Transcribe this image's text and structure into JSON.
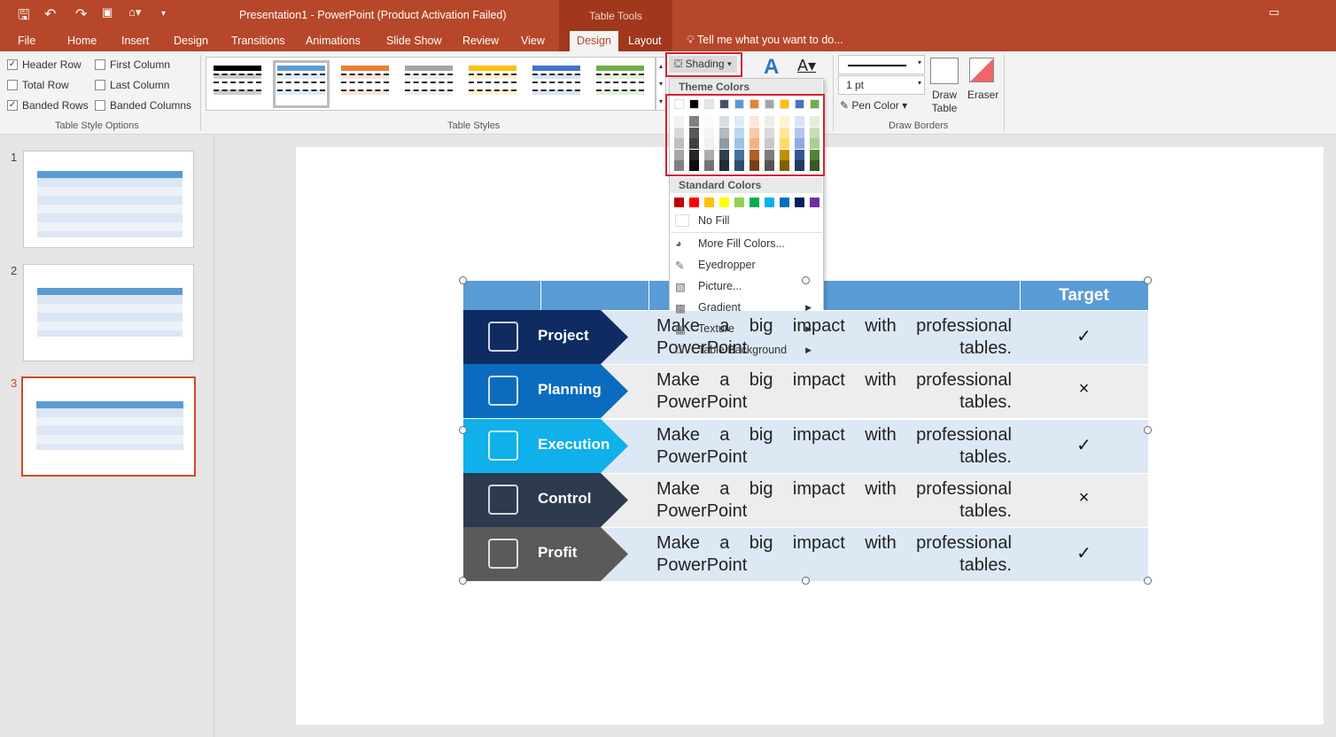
{
  "window": {
    "title": "Presentation1 - PowerPoint (Product Activation Failed)",
    "context_tab_group": "Table Tools"
  },
  "tabs": [
    "File",
    "Home",
    "Insert",
    "Design",
    "Transitions",
    "Animations",
    "Slide Show",
    "Review",
    "View",
    "Design",
    "Layout"
  ],
  "active_tab": "Design",
  "tell_me": "Tell me what you want to do...",
  "style_options": {
    "header_row": {
      "label": "Header Row",
      "checked": true
    },
    "first_column": {
      "label": "First Column",
      "checked": false
    },
    "total_row": {
      "label": "Total Row",
      "checked": false
    },
    "last_column": {
      "label": "Last Column",
      "checked": false
    },
    "banded_rows": {
      "label": "Banded Rows",
      "checked": true
    },
    "banded_columns": {
      "label": "Banded Columns",
      "checked": false
    },
    "group_label": "Table Style Options"
  },
  "table_styles": {
    "group_label": "Table Styles",
    "colors": [
      "#000000",
      "#5b9bd5",
      "#ed7d31",
      "#a5a5a5",
      "#ffc000",
      "#4472c4",
      "#70ad47"
    ]
  },
  "shading": {
    "label": "Shading"
  },
  "draw_borders": {
    "pen_weight": "1 pt",
    "pen_color": "Pen Color",
    "draw_table": "Draw Table",
    "eraser": "Eraser",
    "group_label": "Draw Borders"
  },
  "shading_menu": {
    "theme_header": "Theme Colors",
    "theme_colors": [
      "#ffffff",
      "#000000",
      "#e7e6e6",
      "#44546a",
      "#5b9bd5",
      "#ed7d31",
      "#a5a5a5",
      "#ffc000",
      "#4472c4",
      "#70ad47"
    ],
    "standard_header": "Standard Colors",
    "standard_colors": [
      "#c00000",
      "#ff0000",
      "#ffc000",
      "#ffff00",
      "#92d050",
      "#00b050",
      "#00b0f0",
      "#0070c0",
      "#002060",
      "#7030a0"
    ],
    "items": [
      {
        "label": "No Fill",
        "icon": "no-fill-icon"
      },
      {
        "label": "More Fill Colors...",
        "icon": "color-wheel-icon"
      },
      {
        "label": "Eyedropper",
        "icon": "eyedropper-icon"
      },
      {
        "label": "Picture...",
        "icon": "picture-icon"
      },
      {
        "label": "Gradient",
        "icon": "gradient-icon",
        "submenu": true
      },
      {
        "label": "Texture",
        "icon": "texture-icon",
        "submenu": true
      },
      {
        "label": "Table Background",
        "icon": "paint-bucket-icon",
        "submenu": true
      }
    ]
  },
  "slides": [
    {
      "number": "1"
    },
    {
      "number": "2"
    },
    {
      "number": "3",
      "selected": true
    }
  ],
  "table": {
    "header": [
      "",
      "",
      "",
      "Target"
    ],
    "rows": [
      {
        "label": "Project",
        "color": "#0f2c62",
        "text1": "Make a big impact with professional",
        "text2": "PowerPoint tables.",
        "target": "✓"
      },
      {
        "label": "Planning",
        "color": "#0b6cbf",
        "text1": "Make a big impact with professional",
        "text2": "PowerPoint tables.",
        "target": "×"
      },
      {
        "label": "Execution",
        "color": "#10b0ea",
        "text1": "Make a big impact with professional",
        "text2": "PowerPoint tables.",
        "target": "✓"
      },
      {
        "label": "Control",
        "color": "#2e3a4e",
        "text1": "Make a big impact with professional",
        "text2": "PowerPoint tables.",
        "target": "×"
      },
      {
        "label": "Profit",
        "color": "#5a5a5a",
        "text1": "Make a big impact with professional",
        "text2": "PowerPoint tables.",
        "target": "✓"
      }
    ]
  }
}
